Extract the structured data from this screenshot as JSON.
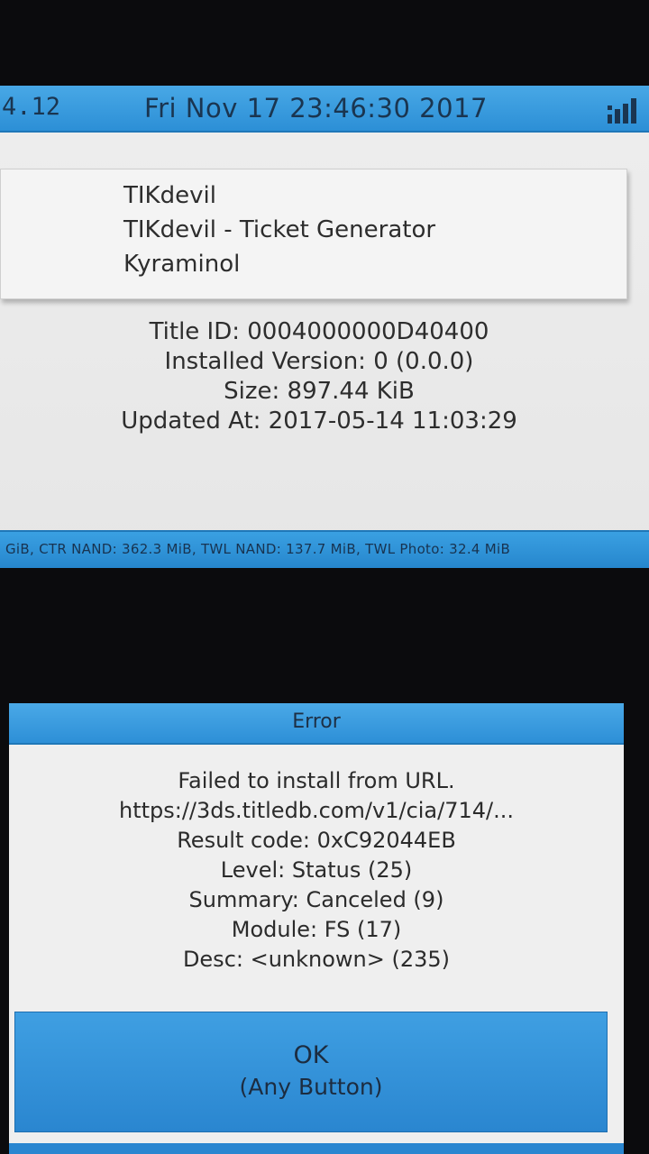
{
  "top_bar": {
    "version": "4.12",
    "datetime": "Fri Nov 17 23:46:30 2017",
    "signal_icon": "wifi-signal-icon"
  },
  "title_info": {
    "name": "TIKdevil",
    "full_name": "TIKdevil - Ticket Generator",
    "author": "Kyraminol"
  },
  "details": {
    "title_id": "Title ID: 0004000000D40400",
    "installed_version": "Installed Version: 0 (0.0.0)",
    "size": "Size: 897.44 KiB",
    "updated_at": "Updated At: 2017-05-14 11:03:29"
  },
  "storage_bar": {
    "text": "GiB, CTR NAND: 362.3 MiB, TWL NAND: 137.7 MiB, TWL Photo: 32.4 MiB"
  },
  "error_dialog": {
    "title": "Error",
    "messages": [
      "Failed to install from URL.",
      "https://3ds.titledb.com/v1/cia/714/...",
      "Result code: 0xC92044EB",
      "Level: Status (25)",
      "Summary: Canceled (9)",
      "Module: FS (17)",
      "Desc: <unknown> (235)"
    ],
    "ok_label": "OK",
    "ok_sublabel": "(Any Button)"
  },
  "colors": {
    "accent": "#2c8fd6",
    "background": "#eeeeee"
  }
}
